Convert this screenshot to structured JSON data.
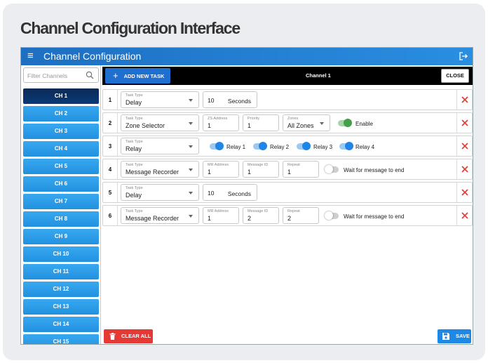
{
  "page": {
    "title": "Channel Configuration Interface"
  },
  "appbar": {
    "title": "Channel Configuration",
    "menu_icon": "≡"
  },
  "sidebar": {
    "filter_placeholder": "Filter Channels",
    "channels": [
      "CH 1",
      "CH 2",
      "CH 3",
      "CH 4",
      "CH 5",
      "CH 6",
      "CH 7",
      "CH 8",
      "CH 9",
      "CH 10",
      "CH 11",
      "CH 12",
      "CH 13",
      "CH 14",
      "CH 15"
    ],
    "active_index": 0
  },
  "toolbar": {
    "add_label": "ADD NEW TASK",
    "channel_name": "Channel 1",
    "close_label": "CLOSE"
  },
  "tasks": [
    {
      "num": "1",
      "type_label": "Task Type",
      "type": "Delay",
      "delay_value": "10",
      "delay_unit": "Seconds"
    },
    {
      "num": "2",
      "type_label": "Task Type",
      "type": "Zone Selector",
      "zs_label": "ZS Address",
      "zs_value": "1",
      "priority_label": "Priority",
      "priority_value": "1",
      "zones_label": "Zones",
      "zones_value": "All Zones",
      "enable_label": "Enable",
      "enable_on": true
    },
    {
      "num": "3",
      "type_label": "Task Type",
      "type": "Relay",
      "relays": [
        {
          "label": "Relay 1",
          "on": true
        },
        {
          "label": "Relay 2",
          "on": true
        },
        {
          "label": "Relay 3",
          "on": true
        },
        {
          "label": "Relay 4",
          "on": true
        }
      ]
    },
    {
      "num": "4",
      "type_label": "Task Type",
      "type": "Message Recorder",
      "mr_label": "MR Address",
      "mr_value": "1",
      "msg_label": "Message ID",
      "msg_value": "1",
      "repeat_label": "Repeat",
      "repeat_value": "1",
      "wait_label": "Wait for message to end",
      "wait_on": false
    },
    {
      "num": "5",
      "type_label": "Task Type",
      "type": "Delay",
      "delay_value": "10",
      "delay_unit": "Seconds"
    },
    {
      "num": "6",
      "type_label": "Task Type",
      "type": "Message Recorder",
      "mr_label": "MR Address",
      "mr_value": "1",
      "msg_label": "Message ID",
      "msg_value": "2",
      "repeat_label": "Repeat",
      "repeat_value": "2",
      "wait_label": "Wait for message to end",
      "wait_on": false
    }
  ],
  "footer": {
    "clear_label": "CLEAR ALL",
    "save_label": "SAVE"
  },
  "colors": {
    "appbar": "#1d6fc2",
    "channel": "#2192e0",
    "active_channel": "#0b2a55",
    "add": "#1e6fd0",
    "clear": "#e53935",
    "save": "#1e88e5",
    "delete": "#e53935"
  }
}
